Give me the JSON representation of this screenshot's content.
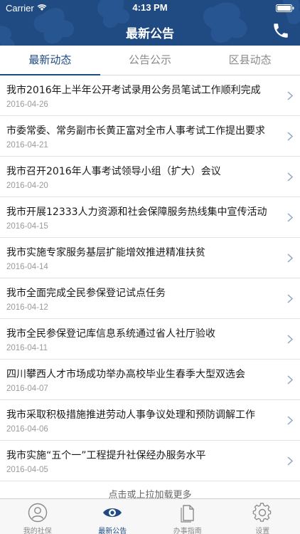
{
  "status_bar": {
    "carrier": "Carrier",
    "time": "4:13 PM"
  },
  "nav": {
    "title": "最新公告"
  },
  "tabs": [
    {
      "label": "最新动态",
      "active": true
    },
    {
      "label": "公告公示",
      "active": false
    },
    {
      "label": "区县动态",
      "active": false
    }
  ],
  "news": [
    {
      "title": "我市2016年上半年公开考试录用公务员笔试工作顺利完成",
      "date": "2016-04-26"
    },
    {
      "title": "市委常委、常务副市长黄正富对全市人事考试工作提出要求",
      "date": "2016-04-21"
    },
    {
      "title": "我市召开2016年人事考试领导小组（扩大）会议",
      "date": "2016-04-20"
    },
    {
      "title": "我市开展12333人力资源和社会保障服务热线集中宣传活动",
      "date": "2016-04-15"
    },
    {
      "title": "我市实施专家服务基层扩能增效推进精准扶贫",
      "date": "2016-04-14"
    },
    {
      "title": "我市全面完成全民参保登记试点任务",
      "date": "2016-04-12"
    },
    {
      "title": "我市全民参保登记库信息系统通过省人社厅验收",
      "date": "2016-04-11"
    },
    {
      "title": "四川攀西人才市场成功举办高校毕业生春季大型双选会",
      "date": "2016-04-07"
    },
    {
      "title": "我市采取积极措施推进劳动人事争议处理和预防调解工作",
      "date": "2016-04-06"
    },
    {
      "title": "我市实施“五个一”工程提升社保经办服务水平",
      "date": "2016-04-05"
    }
  ],
  "load_more": "点击或上拉加载更多",
  "tabbar": [
    {
      "label": "我的社保",
      "icon": "person-icon",
      "active": false
    },
    {
      "label": "最新公告",
      "icon": "eye-icon",
      "active": true
    },
    {
      "label": "办事指南",
      "icon": "document-icon",
      "active": false
    },
    {
      "label": "设置",
      "icon": "gear-icon",
      "active": false
    }
  ],
  "colors": {
    "brand": "#1f4a82",
    "inactive": "#8a8a8a"
  }
}
